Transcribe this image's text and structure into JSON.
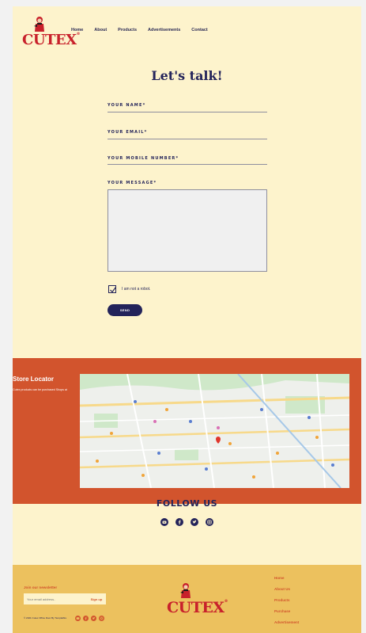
{
  "brand": {
    "name": "CUTEX",
    "tm": "®"
  },
  "nav": {
    "items": [
      "Home",
      "About",
      "Products",
      "Advertisements",
      "Contact"
    ]
  },
  "form": {
    "title": "Let's talk!",
    "fields": {
      "name": "YOUR NAME*",
      "email": "YOUR EMAIL*",
      "mobile": "YOUR MOBILE NUMBER*",
      "message": "YOUR MESSAGE*"
    },
    "captcha_label": "I am not a robot.",
    "send_label": "SEND"
  },
  "store_locator": {
    "title": "Store Locator",
    "description": "Cutex products can be purchased Shops at"
  },
  "follow": {
    "title": "FOLLOW US",
    "icons": [
      "youtube-icon",
      "facebook-icon",
      "twitter-icon",
      "instagram-icon"
    ]
  },
  "footer": {
    "newsletter_title": "Join our newsletter",
    "email_placeholder": "Your email address..",
    "signup_label": "Sign up",
    "copyright": "© 2021 Cutex Office Door By Templatfire",
    "links": [
      "Home",
      "About Us",
      "Products",
      "Purchase",
      "Advertisement"
    ]
  },
  "colors": {
    "navy": "#23235a",
    "accent_red": "#c8212b",
    "orange": "#d2542d",
    "cream": "#fdf3cc",
    "gold": "#ecc15e"
  }
}
